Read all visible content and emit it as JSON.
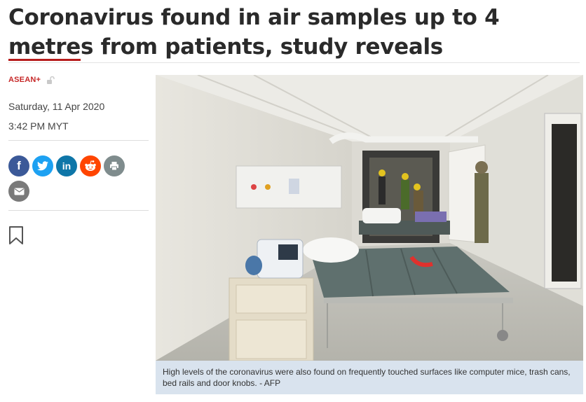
{
  "article": {
    "headline": "Coronavirus found in air samples up to 4 metres from patients, study reveals",
    "category": "ASEAN+",
    "date": "Saturday, 11 Apr 2020",
    "time": "3:42 PM MYT",
    "caption": "High levels of the coronavirus were also found on frequently touched surfaces like computer mice, trash cans, bed rails and door knobs. - AFP"
  },
  "share": {
    "buttons": [
      {
        "icon": "facebook-icon",
        "label": "f",
        "color": "#3b5998"
      },
      {
        "icon": "twitter-icon",
        "label": "",
        "color": "#1da1f2"
      },
      {
        "icon": "linkedin-icon",
        "label": "in",
        "color": "#0e76a8"
      },
      {
        "icon": "reddit-icon",
        "label": "",
        "color": "#ff4500"
      },
      {
        "icon": "print-icon",
        "label": "",
        "color": "#7f8c8d"
      },
      {
        "icon": "email-icon",
        "label": "",
        "color": "#7a7a7a"
      }
    ]
  },
  "colors": {
    "accent": "#b71c1c",
    "category": "#c62828",
    "caption_bg": "#d9e3ee"
  }
}
